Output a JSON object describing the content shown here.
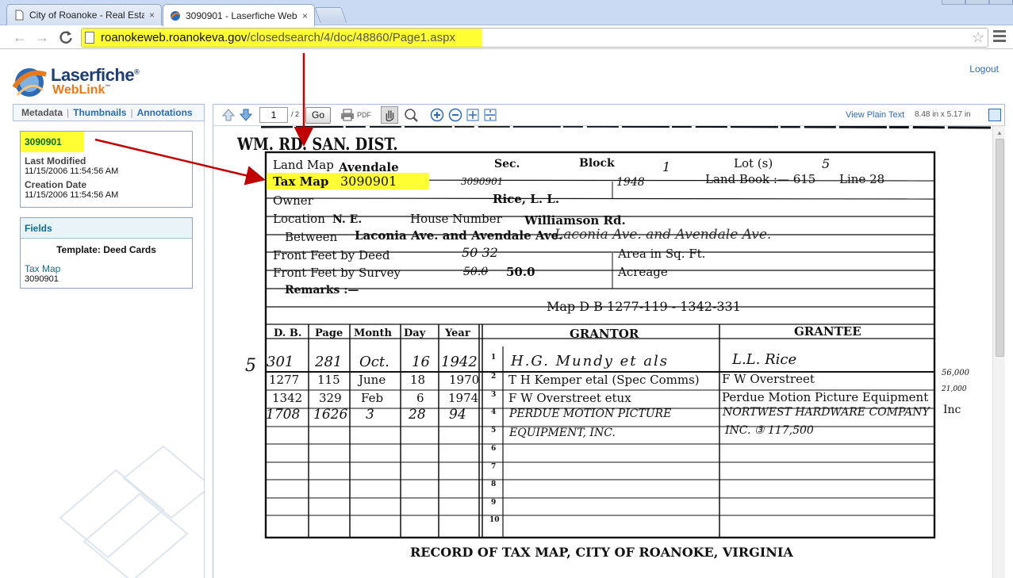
{
  "browser": {
    "tabs": [
      {
        "title": "City of Roanoke - Real Esta",
        "close": "×"
      },
      {
        "title": "3090901 - Laserfiche WebL",
        "close": "×"
      }
    ],
    "url_host": "roanokeweb.roanokeva.gov",
    "url_path": "/closedsearch/4/doc/48860/Page1.aspx"
  },
  "app": {
    "logo_name": "Laserfiche",
    "logo_reg": "®",
    "logo_sub": "WebLink",
    "logo_tm": "™",
    "logout": "Logout",
    "panel_tabs": [
      "Metadata",
      "Thumbnails",
      "Annotations"
    ],
    "doc": {
      "name": "3090901",
      "last_modified_label": "Last Modified",
      "last_modified": "11/15/2006 11:54:56 AM",
      "creation_label": "Creation Date",
      "creation": "11/15/2006 11:54:56 AM"
    },
    "fields": {
      "header": "Fields",
      "template": "Template: Deed Cards",
      "field_label": "Tax Map",
      "field_value": "3090901"
    },
    "viewer": {
      "page": "1",
      "total": "/ 2",
      "go": "Go",
      "pdf": "PDF",
      "view_plain": "View Plain Text",
      "page_size": "8.48 in x 5.17 in"
    }
  },
  "document": {
    "district": "WM. RD. SAN. DIST.",
    "land_map_label": "Land Map",
    "land_map_value": "Avendale",
    "sec_label": "Sec.",
    "block_label": "Block",
    "block_value": "1",
    "lot_label": "Lot (s)",
    "lot_value": "5",
    "tax_map_label": "Tax Map",
    "tax_map_value": "3090901",
    "tax_map_hand": "3090901",
    "year_hand": "1948",
    "land_book_label": "Land Book :— 615",
    "line_label": "Line  28",
    "owner_label": "Owner",
    "owner_value": "Rice, L. L.",
    "location_label": "Location",
    "location_value": "N. E.",
    "house_number_label": "House Number",
    "house_number_value": "Williamson Rd.",
    "between_label": "Between",
    "between_value": "Laconia Ave. and Avendale Ave.",
    "between_hand": "Laconia Ave. and Avendale Ave.",
    "front_deed_label": "Front Feet by Deed",
    "front_deed_value": "50 32",
    "area_label": "Area in Sq. Ft.",
    "front_survey_label": "Front Feet by Survey",
    "front_survey_value": "50.0",
    "front_survey_hand": "50.0",
    "acreage_label": "Acreage",
    "remarks_label": "Remarks :—",
    "map_db": "Map D B 1277-119 - 1342-331",
    "col_headers": [
      "D. B.",
      "Page",
      "Month",
      "Day",
      "Year",
      "GRANTOR",
      "GRANTEE"
    ],
    "row_number_margin": "5",
    "rows": [
      {
        "n": "1",
        "db": "301",
        "page": "281",
        "month": "Oct.",
        "day": "16",
        "year": "1942",
        "grantor": "H.G. Mundy et als",
        "grantee": "L.L. Rice",
        "hand": true
      },
      {
        "n": "2",
        "db": "1277",
        "page": "115",
        "month": "June",
        "day": "18",
        "year": "1970",
        "grantor": "T H Kemper etal (Spec Comms)",
        "grantee": "F W Overstreet",
        "hand": false
      },
      {
        "n": "3",
        "db": "1342",
        "page": "329",
        "month": "Feb",
        "day": "6",
        "year": "1974",
        "grantor": "F W Overstreet  etux",
        "grantee": "Perdue Motion Picture Equipment",
        "hand": false
      },
      {
        "n": "4",
        "db": "1708",
        "page": "1626",
        "month": "3",
        "day": "28",
        "year": "94",
        "grantor": "PERDUE MOTION PICTURE",
        "grantee": "NORTWEST HARDWARE COMPANY",
        "hand": true
      },
      {
        "n": "5",
        "db": "",
        "page": "",
        "month": "",
        "day": "",
        "year": "",
        "grantor": "EQUIPMENT, INC.",
        "grantee": "INC.  ③  117,500",
        "hand": true
      },
      {
        "n": "6",
        "db": "",
        "page": "",
        "month": "",
        "day": "",
        "year": "",
        "grantor": "",
        "grantee": "",
        "hand": false
      },
      {
        "n": "7",
        "db": "",
        "page": "",
        "month": "",
        "day": "",
        "year": "",
        "grantor": "",
        "grantee": "",
        "hand": false
      },
      {
        "n": "8",
        "db": "",
        "page": "",
        "month": "",
        "day": "",
        "year": "",
        "grantor": "",
        "grantee": "",
        "hand": false
      },
      {
        "n": "9",
        "db": "",
        "page": "",
        "month": "",
        "day": "",
        "year": "",
        "grantor": "",
        "grantee": "",
        "hand": false
      },
      {
        "n": "10",
        "db": "",
        "page": "",
        "month": "",
        "day": "",
        "year": "",
        "grantor": "",
        "grantee": "",
        "hand": false
      }
    ],
    "margin_notes": [
      "56,000",
      "21,000",
      "Inc"
    ],
    "footer": "RECORD OF TAX MAP, CITY OF ROANOKE, VIRGINIA"
  },
  "colors": {
    "highlight": "#ffff33",
    "arrow": "#c00000",
    "link": "#2e6bb6",
    "brand_blue": "#1c3e73",
    "brand_orange": "#e87a1e"
  },
  "annotation_arrows": [
    {
      "from": [
        383,
        67
      ],
      "to": [
        383,
        180
      ]
    },
    {
      "from": [
        120,
        176
      ],
      "to": [
        330,
        226
      ]
    }
  ]
}
